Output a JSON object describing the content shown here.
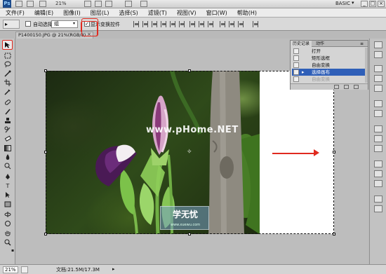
{
  "appbar": {
    "logo": "Ps",
    "zoom": "21%",
    "workspace": "BASIC",
    "workspace_arrow": "▾",
    "window_buttons": [
      "_",
      "□",
      "×"
    ]
  },
  "menu": {
    "items": [
      "文件(F)",
      "编辑(E)",
      "图像(I)",
      "图层(L)",
      "选择(S)",
      "滤镜(T)",
      "视图(V)",
      "窗口(W)",
      "帮助(H)"
    ]
  },
  "options": {
    "tool_preset": "▸",
    "auto_select_label": "自动选择:",
    "auto_select_checked": "",
    "layer_select_value": "组",
    "show_transform_label": "显示变换控件",
    "show_transform_checked": "✓"
  },
  "document": {
    "tab_title": "P1400150.JPG @ 21%(RGB/8)",
    "tab_close": "×"
  },
  "canvas": {
    "watermark": "www.pHome.NET",
    "logo_text": "学无忧",
    "logo_sub": "www.xuewu.com"
  },
  "history": {
    "tabs": [
      "历史记录",
      "动作"
    ],
    "rows": [
      {
        "label": "打开",
        "active": false
      },
      {
        "label": "矩形选框",
        "active": false
      },
      {
        "label": "自由变换",
        "active": false
      },
      {
        "label": "选择画布",
        "active": true
      },
      {
        "label": "自由变换",
        "active": false,
        "disabled": true
      }
    ]
  },
  "status": {
    "zoom": "21%",
    "doc_size": "文档:21.5M/17.3M",
    "arrow": "▸"
  },
  "colors": {
    "foreground": "#e8000a",
    "background": "#ffffff",
    "highlight": "#e02a1f",
    "history_active": "#2f5fb8"
  }
}
